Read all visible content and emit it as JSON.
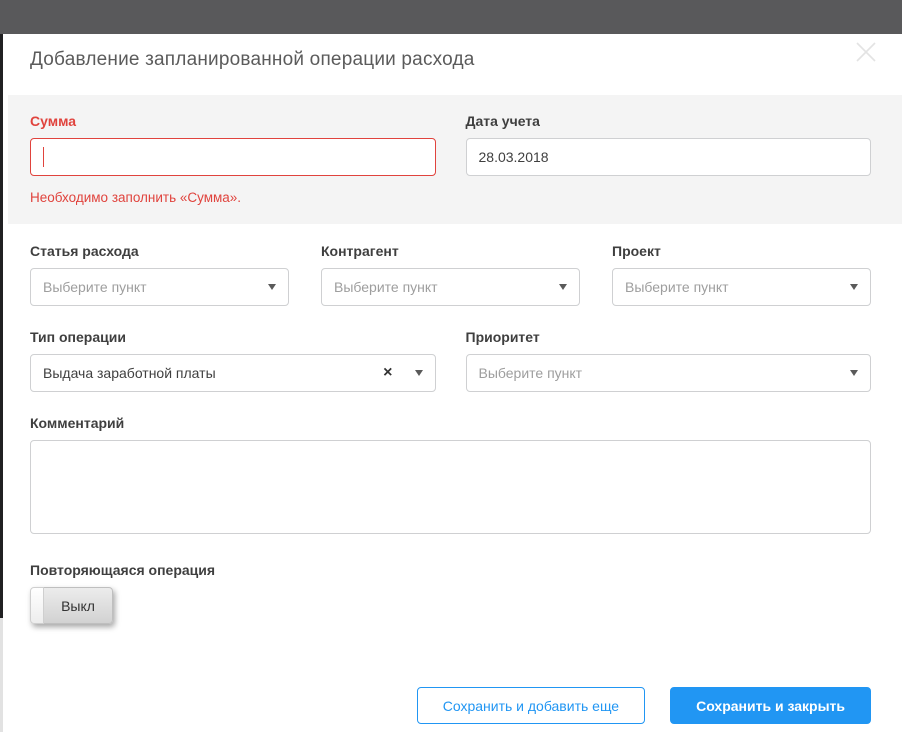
{
  "colors": {
    "accent": "#2196f3",
    "error": "#e0433d",
    "topbar": "#59595b",
    "panel": "#f4f4f4"
  },
  "icons": {
    "close": "x-cross",
    "caret": "triangle-down",
    "clear": "×"
  },
  "modal": {
    "title": "Добавление запланированной операции расхода"
  },
  "panel": {
    "amount": {
      "label": "Сумма",
      "value": "",
      "error": "Необходимо заполнить «Сумма»."
    },
    "date": {
      "label": "Дата учета",
      "value": "28.03.2018"
    }
  },
  "fields": {
    "category": {
      "label": "Статья расхода",
      "placeholder": "Выберите пункт"
    },
    "counterparty": {
      "label": "Контрагент",
      "placeholder": "Выберите пункт"
    },
    "project": {
      "label": "Проект",
      "placeholder": "Выберите пункт"
    },
    "operation_type": {
      "label": "Тип операции",
      "value": "Выдача заработной платы"
    },
    "priority": {
      "label": "Приоритет",
      "placeholder": "Выберите пункт"
    },
    "comment": {
      "label": "Комментарий",
      "value": ""
    },
    "recurring": {
      "label": "Повторяющаяся операция",
      "state": "Выкл"
    }
  },
  "footer": {
    "save_and_add": "Сохранить и добавить еще",
    "save_and_close": "Сохранить и закрыть"
  }
}
